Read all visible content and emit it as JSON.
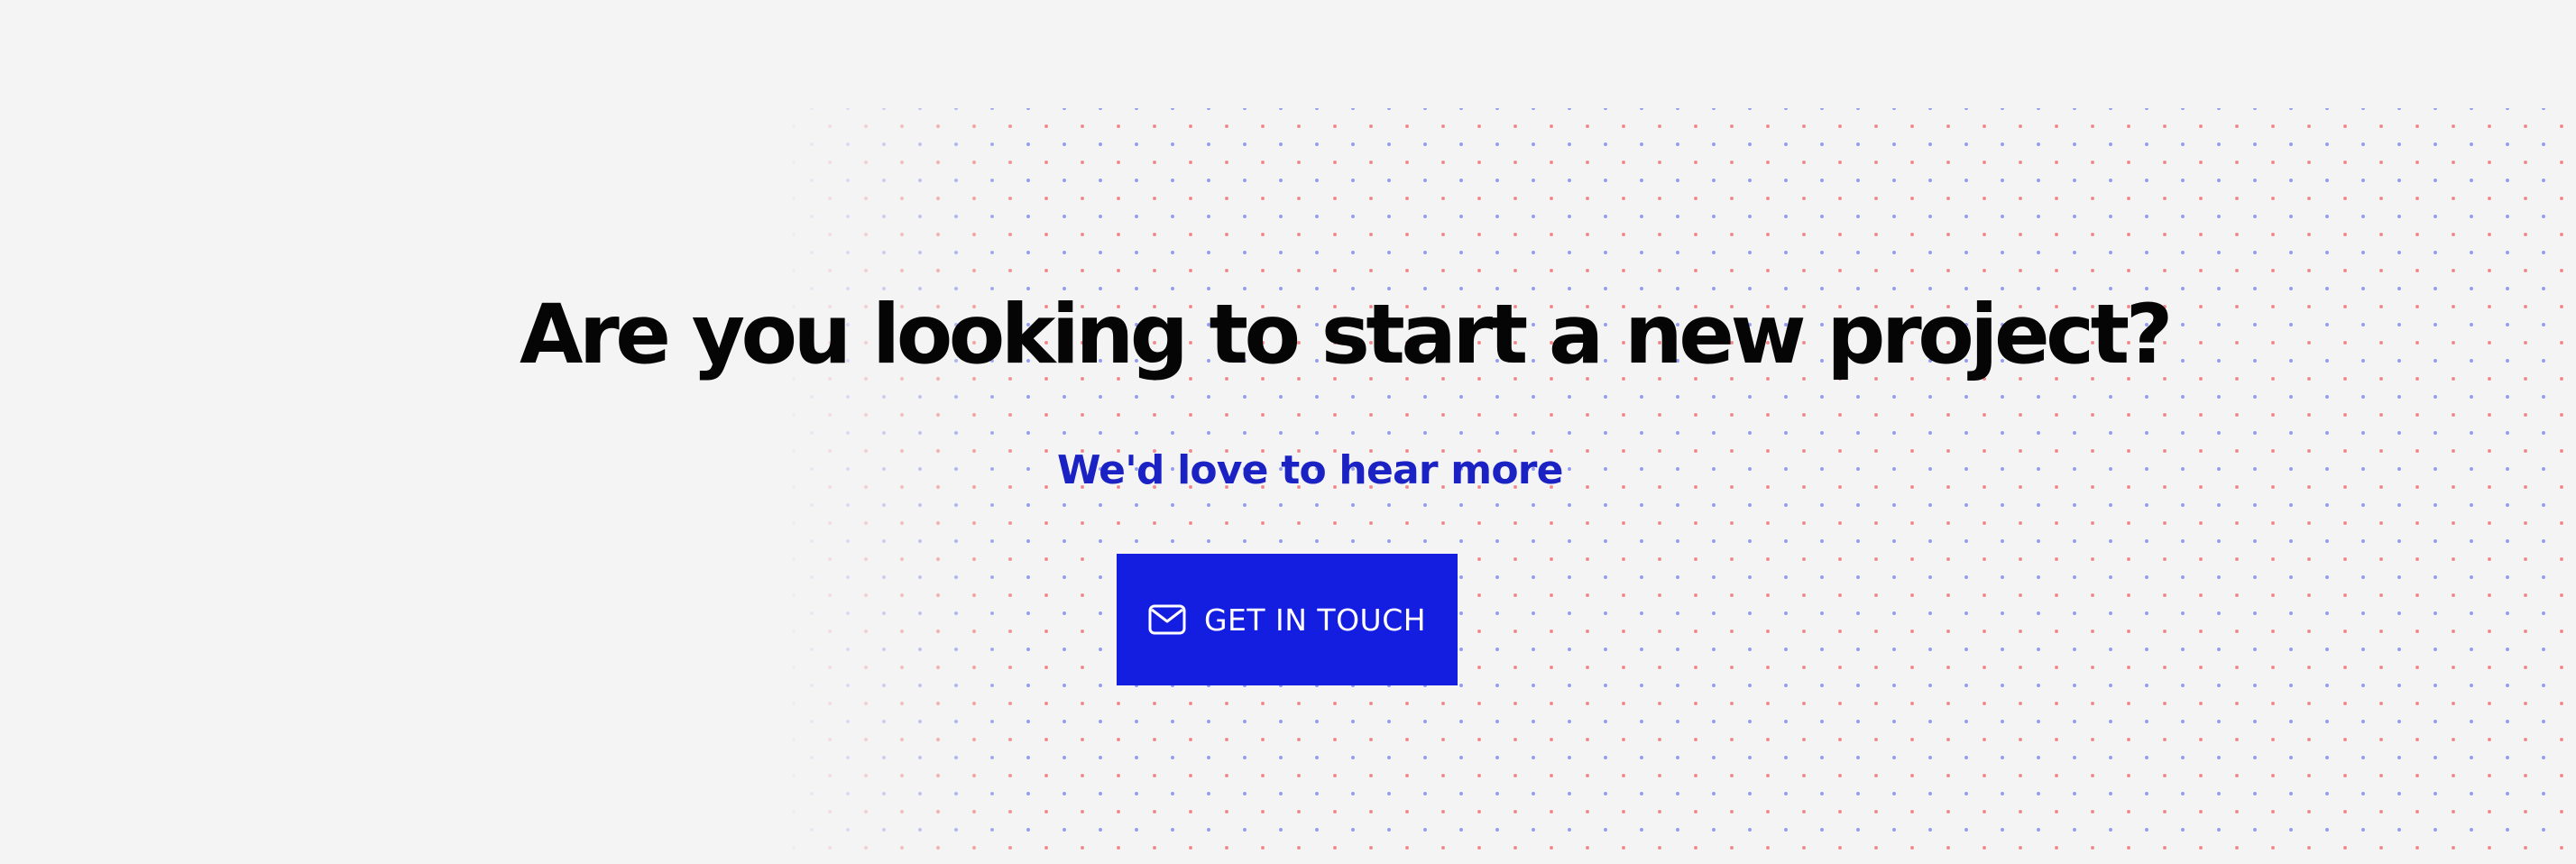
{
  "hero": {
    "heading": "Are you looking to start a new project?",
    "subheading": "We'd love to hear more",
    "cta_label": "GET IN TOUCH",
    "cta_icon": "mail-icon"
  },
  "colors": {
    "background": "#f4f4f4",
    "heading": "#050505",
    "accent": "#1b22c4",
    "button": "#141ee0",
    "dot_red": "#ef5656",
    "dot_blue": "#606ef0"
  }
}
